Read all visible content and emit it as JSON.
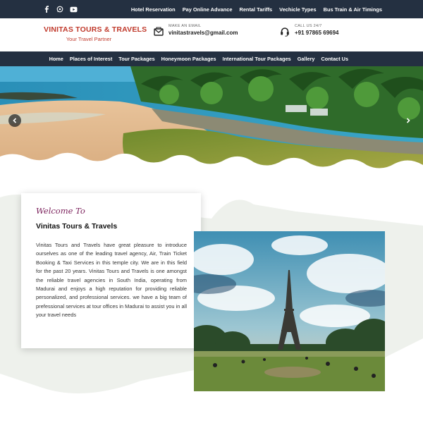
{
  "topbar": {
    "social": [
      "facebook-icon",
      "whatsapp-icon",
      "youtube-icon"
    ],
    "links": [
      "Hotel Reservation",
      "Pay Online Advance",
      "Rental Tariffs",
      "Vechicle Types",
      "Bus Train & Air Timings"
    ]
  },
  "header": {
    "brand_name": "VINITAS TOURS & TRAVELS",
    "brand_tagline": "Your Travel Partner",
    "email_label": "MAKE AN EMAIL",
    "email_value": "vinitastravels@gmail.com",
    "phone_label": "CALL US 24/7",
    "phone_value": "+91 97865 69694"
  },
  "nav": {
    "items": [
      "Home",
      "Places of Interest",
      "Tour Packages",
      "Honeymoon Packages",
      "International Tour Packages",
      "Gallery",
      "Contact Us"
    ]
  },
  "about": {
    "welcome": "Welcome To",
    "title": "Vinitas Tours & Travels",
    "body": "Vinitas Tours and Travels have great pleasure to introduce ourselves as one of the leading travel agency, Air, Train Ticket Booking & Taxi Services in this temple city. We are in this field for the past 20 years. Vinitas Tours and Travels is one amongst the reliable travel agencies in South India, operating from Madurai and enjoys a high reputation for providing reliable personalized, and professional services. we have a big team of prefessional services at tour offices in Madurai to assist you in all your travel needs"
  },
  "colors": {
    "dark_bar": "#243041",
    "brand": "#c0392b",
    "welcome": "#7a1f5a"
  }
}
